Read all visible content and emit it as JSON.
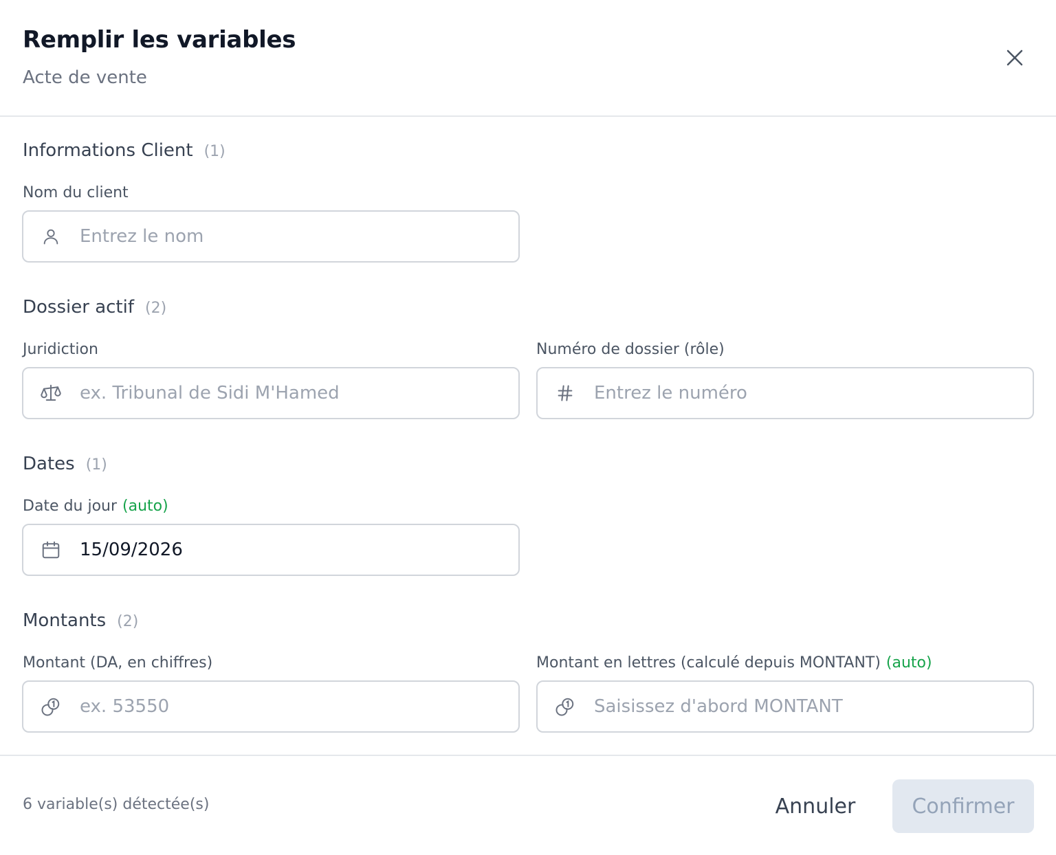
{
  "dialog": {
    "title": "Remplir les variables",
    "subtitle": "Acte de vente",
    "close_icon": "close-icon"
  },
  "sections": [
    {
      "title": "Informations Client",
      "count": "(1)",
      "fields": [
        {
          "label": "Nom du client",
          "auto": "",
          "icon": "user-icon",
          "value": "",
          "placeholder": "Entrez le nom"
        }
      ]
    },
    {
      "title": "Dossier actif",
      "count": "(2)",
      "fields": [
        {
          "label": "Juridiction",
          "auto": "",
          "icon": "scale-icon",
          "value": "",
          "placeholder": "ex. Tribunal de Sidi M'Hamed"
        },
        {
          "label": "Numéro de dossier (rôle)",
          "auto": "",
          "icon": "hash-icon",
          "value": "",
          "placeholder": "Entrez le numéro"
        }
      ]
    },
    {
      "title": "Dates",
      "count": "(1)",
      "fields": [
        {
          "label": "Date du jour",
          "auto": "(auto)",
          "icon": "calendar-icon",
          "value": "15/09/2026",
          "placeholder": ""
        }
      ]
    },
    {
      "title": "Montants",
      "count": "(2)",
      "fields": [
        {
          "label": "Montant (DA, en chiffres)",
          "auto": "",
          "icon": "coins-icon",
          "value": "",
          "placeholder": "ex. 53550"
        },
        {
          "label": "Montant en lettres (calculé depuis MONTANT)",
          "auto": "(auto)",
          "icon": "coins-icon",
          "value": "",
          "placeholder": "Saisissez d'abord MONTANT"
        }
      ]
    }
  ],
  "footer": {
    "info": "6 variable(s) détectée(s)",
    "cancel_label": "Annuler",
    "confirm_label": "Confirmer"
  },
  "colors": {
    "auto": "#16a34a",
    "confirm_disabled_bg": "#e2e8f0",
    "border": "#d1d5db"
  }
}
